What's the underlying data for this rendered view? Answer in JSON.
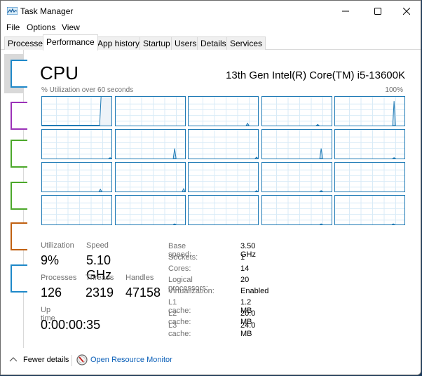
{
  "window": {
    "title": "Task Manager",
    "icon": "task-manager-icon",
    "controls": {
      "minimize": "minimize-icon",
      "maximize": "maximize-icon",
      "close": "close-icon"
    }
  },
  "menu": [
    "File",
    "Options",
    "View"
  ],
  "tabs": [
    {
      "label": "Processes",
      "active": false
    },
    {
      "label": "Performance",
      "active": true
    },
    {
      "label": "App history",
      "active": false
    },
    {
      "label": "Startup",
      "active": false
    },
    {
      "label": "Users",
      "active": false
    },
    {
      "label": "Details",
      "active": false
    },
    {
      "label": "Services",
      "active": false
    }
  ],
  "sidebar": {
    "items": [
      {
        "name": "cpu",
        "color": "#1e88c9",
        "selected": true
      },
      {
        "name": "memory",
        "color": "#9b32b8",
        "selected": false
      },
      {
        "name": "disk-0",
        "color": "#4ca82b",
        "selected": false
      },
      {
        "name": "disk-1",
        "color": "#4ca82b",
        "selected": false
      },
      {
        "name": "ethernet",
        "color": "#c06010",
        "selected": false
      },
      {
        "name": "gpu",
        "color": "#1e88c9",
        "selected": false
      }
    ]
  },
  "cpu": {
    "title": "CPU",
    "model": "13th Gen Intel(R) Core(TM) i5-13600K",
    "graph_label": "% Utilization over 60 seconds",
    "graph_max": "100%",
    "graph_color": "#1f7ab5",
    "logical_graphs": [
      {
        "spike_pos": 0.84,
        "spike_val": 1.0,
        "tail_shaded": true
      },
      {
        "spike_pos": null,
        "spike_val": 0
      },
      {
        "spike_pos": 0.85,
        "spike_val": 0.08
      },
      {
        "spike_pos": 0.8,
        "spike_val": 0.04
      },
      {
        "spike_pos": 0.85,
        "spike_val": 0.85
      },
      {
        "spike_pos": 0.98,
        "spike_val": 0.03
      },
      {
        "spike_pos": 0.85,
        "spike_val": 0.35
      },
      {
        "spike_pos": 0.98,
        "spike_val": 0.05
      },
      {
        "spike_pos": 0.85,
        "spike_val": 0.35
      },
      {
        "spike_pos": 0.85,
        "spike_val": 0.03
      },
      {
        "spike_pos": 0.84,
        "spike_val": 0.08
      },
      {
        "spike_pos": 0.98,
        "spike_val": 0.1
      },
      {
        "spike_pos": 0.98,
        "spike_val": 0.03
      },
      {
        "spike_pos": 0.85,
        "spike_val": 0.03
      },
      {
        "spike_pos": null,
        "spike_val": 0
      },
      {
        "spike_pos": null,
        "spike_val": 0
      },
      {
        "spike_pos": 0.85,
        "spike_val": 0.02
      },
      {
        "spike_pos": null,
        "spike_val": 0
      },
      {
        "spike_pos": 0.85,
        "spike_val": 0.02
      },
      {
        "spike_pos": 0.84,
        "spike_val": 0.02
      }
    ],
    "stats": {
      "utilization_label": "Utilization",
      "utilization": "9%",
      "speed_label": "Speed",
      "speed": "5.10 GHz",
      "processes_label": "Processes",
      "processes": "126",
      "threads_label": "Threads",
      "threads": "2319",
      "handles_label": "Handles",
      "handles": "47158",
      "uptime_label": "Up time",
      "uptime": "0:00:00:35"
    },
    "info": [
      {
        "label": "Base speed:",
        "value": "3.50 GHz"
      },
      {
        "label": "Sockets:",
        "value": "1"
      },
      {
        "label": "Cores:",
        "value": "14"
      },
      {
        "label": "Logical processors:",
        "value": "20"
      },
      {
        "label": "Virtualization:",
        "value": "Enabled"
      },
      {
        "label": "L1 cache:",
        "value": "1.2 MB"
      },
      {
        "label": "L2 cache:",
        "value": "20.0 MB"
      },
      {
        "label": "L3 cache:",
        "value": "24.0 MB"
      }
    ]
  },
  "footer": {
    "fewer_details": "Fewer details",
    "resource_monitor": "Open Resource Monitor"
  }
}
